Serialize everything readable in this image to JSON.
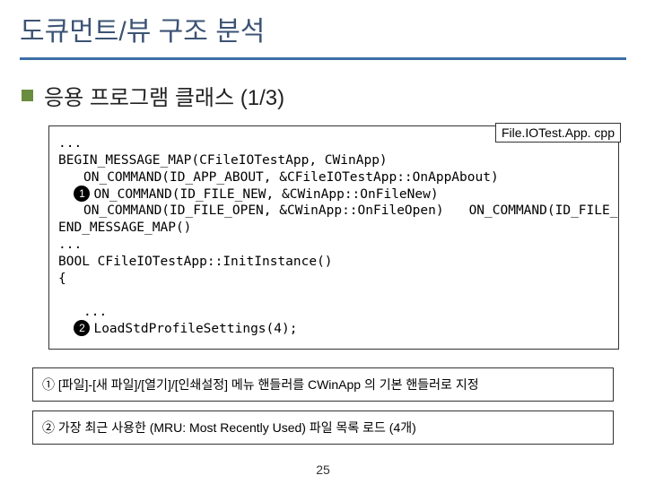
{
  "title": "도큐먼트/뷰 구조 분석",
  "section": {
    "label": "응용 프로그램 클래스 (1/3)"
  },
  "file_tag": "File.IOTest.App. cpp",
  "code": {
    "l1": "...",
    "l2": "BEGIN_MESSAGE_MAP(CFileIOTestApp, CWinApp)",
    "l3": "ON_COMMAND(ID_APP_ABOUT, &CFileIOTestApp::OnAppAbout)",
    "l4": "ON_COMMAND(ID_FILE_NEW, &CWinApp::OnFileNew)",
    "l5": "ON_COMMAND(ID_FILE_OPEN, &CWinApp::OnFileOpen)",
    "l6": "ON_COMMAND(ID_FILE_PRINT_SETUP, &CWinApp::OnFilePrintSetup)",
    "l7": "END_MESSAGE_MAP()",
    "l8": "...",
    "l9": "BOOL CFileIOTestApp::InitInstance()",
    "l10": "{",
    "l11": "...",
    "l12": "LoadStdProfileSettings(4);"
  },
  "notes": {
    "n1": "① [파일]-[새 파일]/[열기]/[인쇄설정] 메뉴 핸들러를 CWinApp 의 기본 핸들러로 지정",
    "n2": "② 가장 최근 사용한 (MRU: Most Recently Used) 파일 목록 로드 (4개)"
  },
  "pagenum": "25",
  "marker": {
    "m1": "1",
    "m2": "2"
  }
}
